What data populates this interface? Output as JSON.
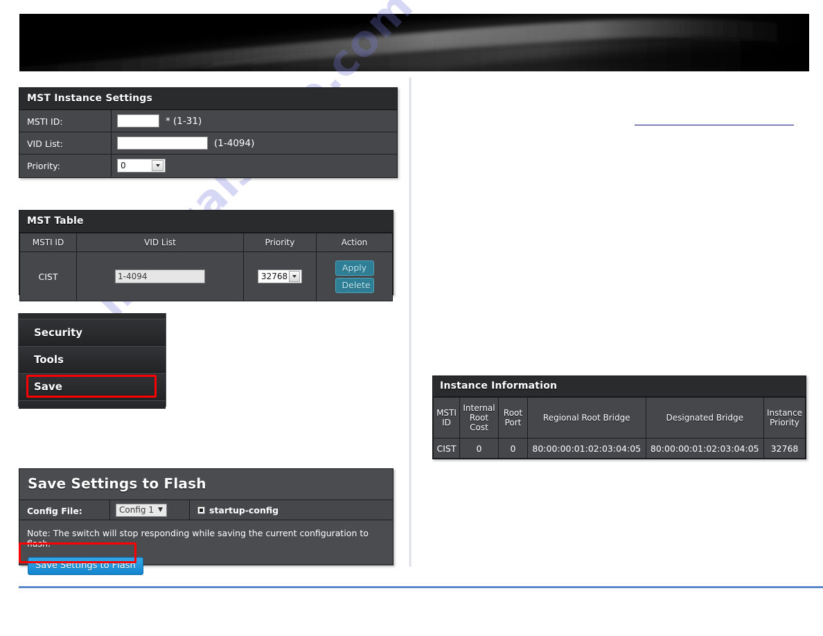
{
  "banner": {
    "alt": "device-banner-image"
  },
  "watermark": {
    "text": "manualshive.com"
  },
  "mst_instance_settings": {
    "title": "MST Instance Settings",
    "rows": [
      {
        "label": "MSTI ID:",
        "value": "",
        "hint": "* (1-31)"
      },
      {
        "label": "VID List:",
        "value": "",
        "hint": "(1-4094)"
      },
      {
        "label": "Priority:",
        "selected": "0"
      }
    ]
  },
  "mst_table": {
    "title": "MST Table",
    "headers": [
      "MSTI ID",
      "VID List",
      "Priority",
      "Action"
    ],
    "rows": [
      {
        "msti_id": "CIST",
        "vid_list": "1-4094",
        "priority": "32768",
        "apply_label": "Apply",
        "delete_label": "Delete"
      }
    ]
  },
  "menu": {
    "items": [
      {
        "label": "Security",
        "highlighted": false
      },
      {
        "label": "Tools",
        "highlighted": false
      },
      {
        "label": "Save",
        "highlighted": true
      }
    ]
  },
  "save_panel": {
    "title": "Save Settings to Flash",
    "config_file_label": "Config File:",
    "config_file_selected": "Config 1",
    "startup_config_label": "startup-config",
    "note": "Note: The switch will stop responding while saving the current configuration to flash.",
    "save_button_label": "Save Settings to Flash"
  },
  "instance_information": {
    "title": "Instance Information",
    "headers": [
      "MSTI ID",
      "Internal Root Cost",
      "Root Port",
      "Regional Root Bridge",
      "Designated Bridge",
      "Instance Priority"
    ],
    "rows": [
      {
        "msti_id": "CIST",
        "internal_root_cost": "0",
        "root_port": "0",
        "regional_root_bridge": "80:00:00:01:02:03:04:05",
        "designated_bridge": "80:00:00:01:02:03:04:05",
        "instance_priority": "32768"
      }
    ]
  },
  "colors": {
    "panel_bg": "#45474b",
    "panel_header": "#2a2b2d",
    "teal_button": "#2e7f96",
    "blue_button": "#1f93db",
    "highlight_red": "#ff0000",
    "rule_blue": "#5a88c8",
    "right_rule_navy": "#11117f"
  }
}
